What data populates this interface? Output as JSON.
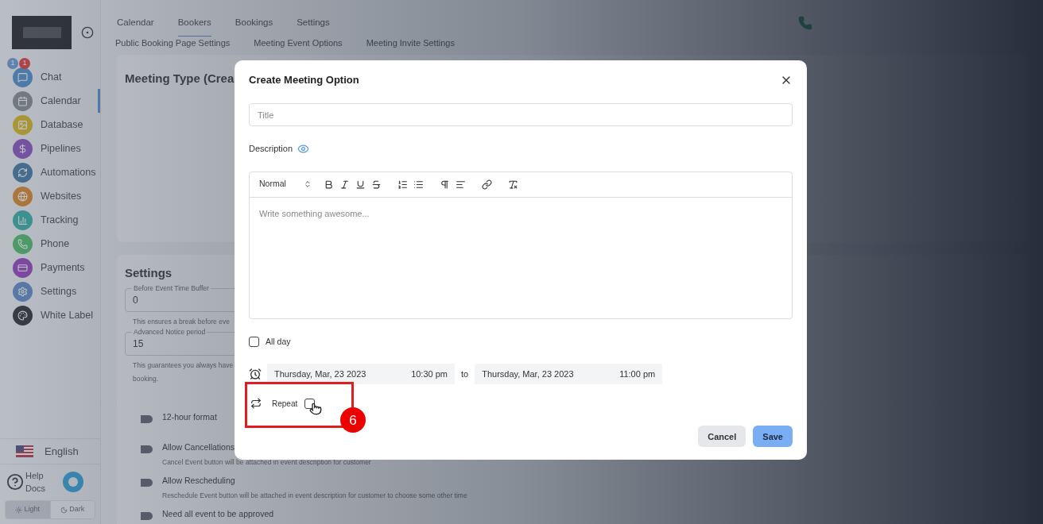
{
  "sidebar": {
    "items": [
      {
        "label": "Chat",
        "selected": false,
        "badges": [
          "1",
          "1"
        ]
      },
      {
        "label": "Calendar",
        "selected": true
      },
      {
        "label": "Database",
        "selected": false
      },
      {
        "label": "Pipelines",
        "selected": false
      },
      {
        "label": "Automations",
        "selected": false
      },
      {
        "label": "Websites",
        "selected": false
      },
      {
        "label": "Tracking",
        "selected": false
      },
      {
        "label": "Phone",
        "selected": false
      },
      {
        "label": "Payments",
        "selected": false
      },
      {
        "label": "Settings",
        "selected": false
      },
      {
        "label": "White Label",
        "selected": false
      }
    ],
    "language": "English",
    "help": [
      "Help",
      "Docs"
    ],
    "theme": [
      {
        "label": "Light",
        "selected": true
      },
      {
        "label": "Dark",
        "selected": false
      }
    ]
  },
  "tabs": [
    {
      "label": "Calendar",
      "selected": false
    },
    {
      "label": "Bookers",
      "selected": true
    },
    {
      "label": "Bookings",
      "selected": false
    },
    {
      "label": "Settings",
      "selected": false
    }
  ],
  "subtabs": [
    "Public Booking Page Settings",
    "Meeting Event Options",
    "Meeting Invite Settings"
  ],
  "meeting_card": {
    "title": "Meeting Type (Crea"
  },
  "settings_card": {
    "title": "Settings",
    "fields": [
      {
        "label": "Before Event Time Buffer",
        "value": "0",
        "help": [
          "This ensures a break before eve"
        ]
      },
      {
        "label": "Advanced Notice period",
        "value": "15",
        "help": [
          "This guarantees you always have",
          "booking."
        ]
      }
    ],
    "toggles": [
      {
        "label": "12-hour format",
        "on": false
      },
      {
        "label": "Allow Cancellations",
        "description": "Cancel Event button will be attached in event description for customer",
        "on": false
      },
      {
        "label": "Allow Rescheduling",
        "description": "Reschedule Event button will be attached in event description for customer to choose some other time",
        "on": false
      },
      {
        "label": "Need all event to be approved",
        "on": false
      }
    ]
  },
  "modal": {
    "title": "Create Meeting Option",
    "title_placeholder": "Title",
    "description_label": "Description",
    "editor": {
      "format": "Normal",
      "placeholder": "Write something awesome..."
    },
    "all_day": {
      "label": "All day",
      "checked": false
    },
    "start": {
      "date": "Thursday, Mar, 23 2023",
      "time": "10:30 pm"
    },
    "separator": "to",
    "end": {
      "date": "Thursday, Mar, 23 2023",
      "time": "11:00 pm"
    },
    "repeat": {
      "label": "Repeat",
      "checked": false
    },
    "buttons": [
      {
        "label": "Cancel",
        "kind": "secondary"
      },
      {
        "label": "Save",
        "kind": "primary"
      }
    ]
  },
  "annotation": {
    "number": "6"
  }
}
